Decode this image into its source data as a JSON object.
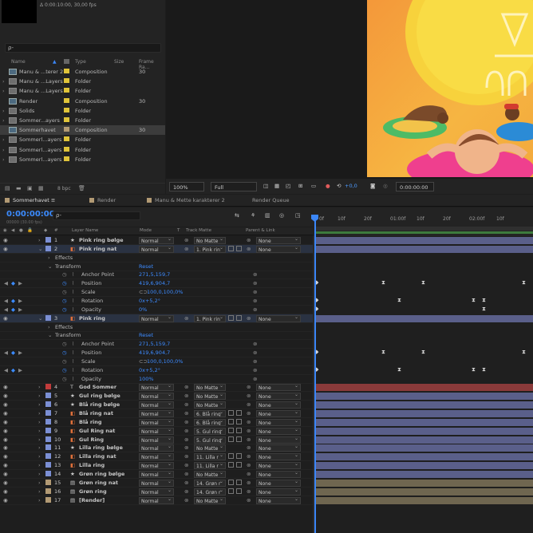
{
  "project": {
    "info": "Δ 0:00:10:00, 30,00 fps",
    "search_placeholder": "ρ-",
    "columns": {
      "name": "Name",
      "type": "Type",
      "size": "Size",
      "frame_rate": "Frame Ra..."
    },
    "items": [
      {
        "name": "Manu & ...terer 2",
        "type": "Composition",
        "fps": "30",
        "label": "#e0c43a",
        "icon": "composition-icon",
        "selected": false
      },
      {
        "name": "Manu & ...Layers",
        "type": "Folder",
        "fps": "",
        "label": "#e0c43a",
        "icon": "folder-icon",
        "selected": false
      },
      {
        "name": "Manu & ...Layers",
        "type": "Folder",
        "fps": "",
        "label": "#e0c43a",
        "icon": "folder-icon",
        "selected": false
      },
      {
        "name": "Render",
        "type": "Composition",
        "fps": "30",
        "label": "#e0c43a",
        "icon": "composition-icon",
        "selected": false
      },
      {
        "name": "Solids",
        "type": "Folder",
        "fps": "",
        "label": "#e0c43a",
        "icon": "folder-icon",
        "selected": false
      },
      {
        "name": "Sommer...ayers",
        "type": "Folder",
        "fps": "",
        "label": "#e0c43a",
        "icon": "folder-icon",
        "selected": false
      },
      {
        "name": "Sommerhavet",
        "type": "Composition",
        "fps": "30",
        "label": "#b29a74",
        "icon": "composition-icon",
        "selected": true
      },
      {
        "name": "Sommerl...ayers",
        "type": "Folder",
        "fps": "",
        "label": "#e0c43a",
        "icon": "folder-icon",
        "selected": false
      },
      {
        "name": "Sommerl...ayers",
        "type": "Folder",
        "fps": "",
        "label": "#e0c43a",
        "icon": "folder-icon",
        "selected": false
      },
      {
        "name": "Sommerl...ayers",
        "type": "Folder",
        "fps": "",
        "label": "#e0c43a",
        "icon": "folder-icon",
        "selected": false
      }
    ],
    "footer_bpc": "8 bpc"
  },
  "viewer": {
    "zoom": "100%",
    "resolution": "Full",
    "exposure": "+0,0",
    "timecode": "0:00:00:00"
  },
  "tabs": [
    {
      "label": "Sommerhavet",
      "active": true
    },
    {
      "label": "Render",
      "active": false
    },
    {
      "label": "Manu & Mette karakterer 2",
      "active": false
    },
    {
      "label": "Render Queue",
      "active": false
    }
  ],
  "timeline": {
    "timecode": "0:00:00:00",
    "fps_sub": "00000 (30.00 fps)",
    "search_placeholder": "ρ-",
    "columns": {
      "num": "#",
      "layer_name": "Layer Name",
      "mode": "Mode",
      "t": "T",
      "track_matte": "Track Matte",
      "parent": "Parent & Link"
    },
    "ruler_ticks": [
      "0f",
      "10f",
      "20f",
      "01:00f",
      "10f",
      "20f",
      "02:00f",
      "10f"
    ],
    "rows": [
      {
        "kind": "layer",
        "num": "1",
        "name": "Pink ring bølge",
        "label": "#7b8fd4",
        "mode": "Normal",
        "matte": "No Matte",
        "parent": "None",
        "type": "shape",
        "bar": "#5a5f8a"
      },
      {
        "kind": "layer",
        "num": "2",
        "name": "Pink ring nat",
        "label": "#7b8fd4",
        "mode": "Normal",
        "matte": "1. Pink rin",
        "parent": "None",
        "type": "precomp",
        "bar": "#5a5f8a",
        "open": true
      },
      {
        "kind": "group",
        "name": "Effects",
        "depth": 1
      },
      {
        "kind": "group",
        "name": "Transform",
        "value": "Reset",
        "depth": 1,
        "open": true
      },
      {
        "kind": "prop",
        "name": "Anchor Point",
        "value": "271,5,159,7"
      },
      {
        "kind": "prop",
        "name": "Position",
        "value": "419,6,904,7",
        "keyed": true
      },
      {
        "kind": "prop",
        "name": "Scale",
        "value": "100,0,100,0%",
        "link": true
      },
      {
        "kind": "prop",
        "name": "Rotation",
        "value": "0x+5,2°",
        "keyed": true
      },
      {
        "kind": "prop",
        "name": "Opacity",
        "value": "0%",
        "keyed": true
      },
      {
        "kind": "layer",
        "num": "3",
        "name": "Pink ring",
        "label": "#7b8fd4",
        "mode": "Normal",
        "matte": "1. Pink rin",
        "parent": "None",
        "type": "precomp",
        "bar": "#5a5f8a",
        "open": true
      },
      {
        "kind": "group",
        "name": "Effects",
        "depth": 1
      },
      {
        "kind": "group",
        "name": "Transform",
        "value": "Reset",
        "depth": 1,
        "open": true
      },
      {
        "kind": "prop",
        "name": "Anchor Point",
        "value": "271,5,159,7"
      },
      {
        "kind": "prop",
        "name": "Position",
        "value": "419,6,904,7",
        "keyed": true
      },
      {
        "kind": "prop",
        "name": "Scale",
        "value": "100,0,100,0%",
        "link": true
      },
      {
        "kind": "prop",
        "name": "Rotation",
        "value": "0x+5,2°",
        "keyed": true
      },
      {
        "kind": "prop",
        "name": "Opacity",
        "value": "100%"
      },
      {
        "kind": "layer",
        "num": "4",
        "name": "God Sommer",
        "label": "#c23b3b",
        "mode": "Normal",
        "matte": "No Matte",
        "parent": "None",
        "type": "text",
        "bar": "#8a3a3a"
      },
      {
        "kind": "layer",
        "num": "5",
        "name": "Gul ring bølge",
        "label": "#7b8fd4",
        "mode": "Normal",
        "matte": "No Matte",
        "parent": "None",
        "type": "shape",
        "bar": "#5a5f8a"
      },
      {
        "kind": "layer",
        "num": "6",
        "name": "Blå ring bølge",
        "label": "#7b8fd4",
        "mode": "Normal",
        "matte": "No Matte",
        "parent": "None",
        "type": "shape",
        "bar": "#5a5f8a"
      },
      {
        "kind": "layer",
        "num": "7",
        "name": "Blå ring nat",
        "label": "#7b8fd4",
        "mode": "Normal",
        "matte": "6. Blå ring",
        "parent": "None",
        "type": "precomp",
        "bar": "#5a5f8a"
      },
      {
        "kind": "layer",
        "num": "8",
        "name": "Blå ring",
        "label": "#7b8fd4",
        "mode": "Normal",
        "matte": "6. Blå ring",
        "parent": "None",
        "type": "precomp",
        "bar": "#5a5f8a"
      },
      {
        "kind": "layer",
        "num": "9",
        "name": "Gul Ring nat",
        "label": "#7b8fd4",
        "mode": "Normal",
        "matte": "5. Gul ring",
        "parent": "None",
        "type": "precomp",
        "bar": "#5a5f8a"
      },
      {
        "kind": "layer",
        "num": "10",
        "name": "Gul Ring",
        "label": "#7b8fd4",
        "mode": "Normal",
        "matte": "5. Gul ring",
        "parent": "None",
        "type": "precomp",
        "bar": "#5a5f8a"
      },
      {
        "kind": "layer",
        "num": "11",
        "name": "Lilla ring bølge",
        "label": "#7b8fd4",
        "mode": "Normal",
        "matte": "No Matte",
        "parent": "None",
        "type": "shape",
        "bar": "#5a5f8a"
      },
      {
        "kind": "layer",
        "num": "12",
        "name": "Lilla ring nat",
        "label": "#7b8fd4",
        "mode": "Normal",
        "matte": "11. Lilla r",
        "parent": "None",
        "type": "precomp",
        "bar": "#5a5f8a"
      },
      {
        "kind": "layer",
        "num": "13",
        "name": "Lilla ring",
        "label": "#7b8fd4",
        "mode": "Normal",
        "matte": "11. Lilla r",
        "parent": "None",
        "type": "precomp",
        "bar": "#5a5f8a"
      },
      {
        "kind": "layer",
        "num": "14",
        "name": "Grøn ring bølge",
        "label": "#7b8fd4",
        "mode": "Normal",
        "matte": "No Matte",
        "parent": "None",
        "type": "shape",
        "bar": "#5a5f8a"
      },
      {
        "kind": "layer",
        "num": "15",
        "name": "Grøn ring nat",
        "label": "#b29a74",
        "mode": "Normal",
        "matte": "14. Grøn r",
        "parent": "None",
        "type": "comp",
        "bar": "#6f6650"
      },
      {
        "kind": "layer",
        "num": "16",
        "name": "Grøn ring",
        "label": "#b29a74",
        "mode": "Normal",
        "matte": "14. Grøn r",
        "parent": "None",
        "type": "comp",
        "bar": "#6f6650"
      },
      {
        "kind": "layer",
        "num": "17",
        "name": "[Render]",
        "label": "#b29a74",
        "mode": "Normal",
        "matte": "No Matte",
        "parent": "None",
        "type": "comp",
        "bar": "#6f6650"
      }
    ]
  }
}
